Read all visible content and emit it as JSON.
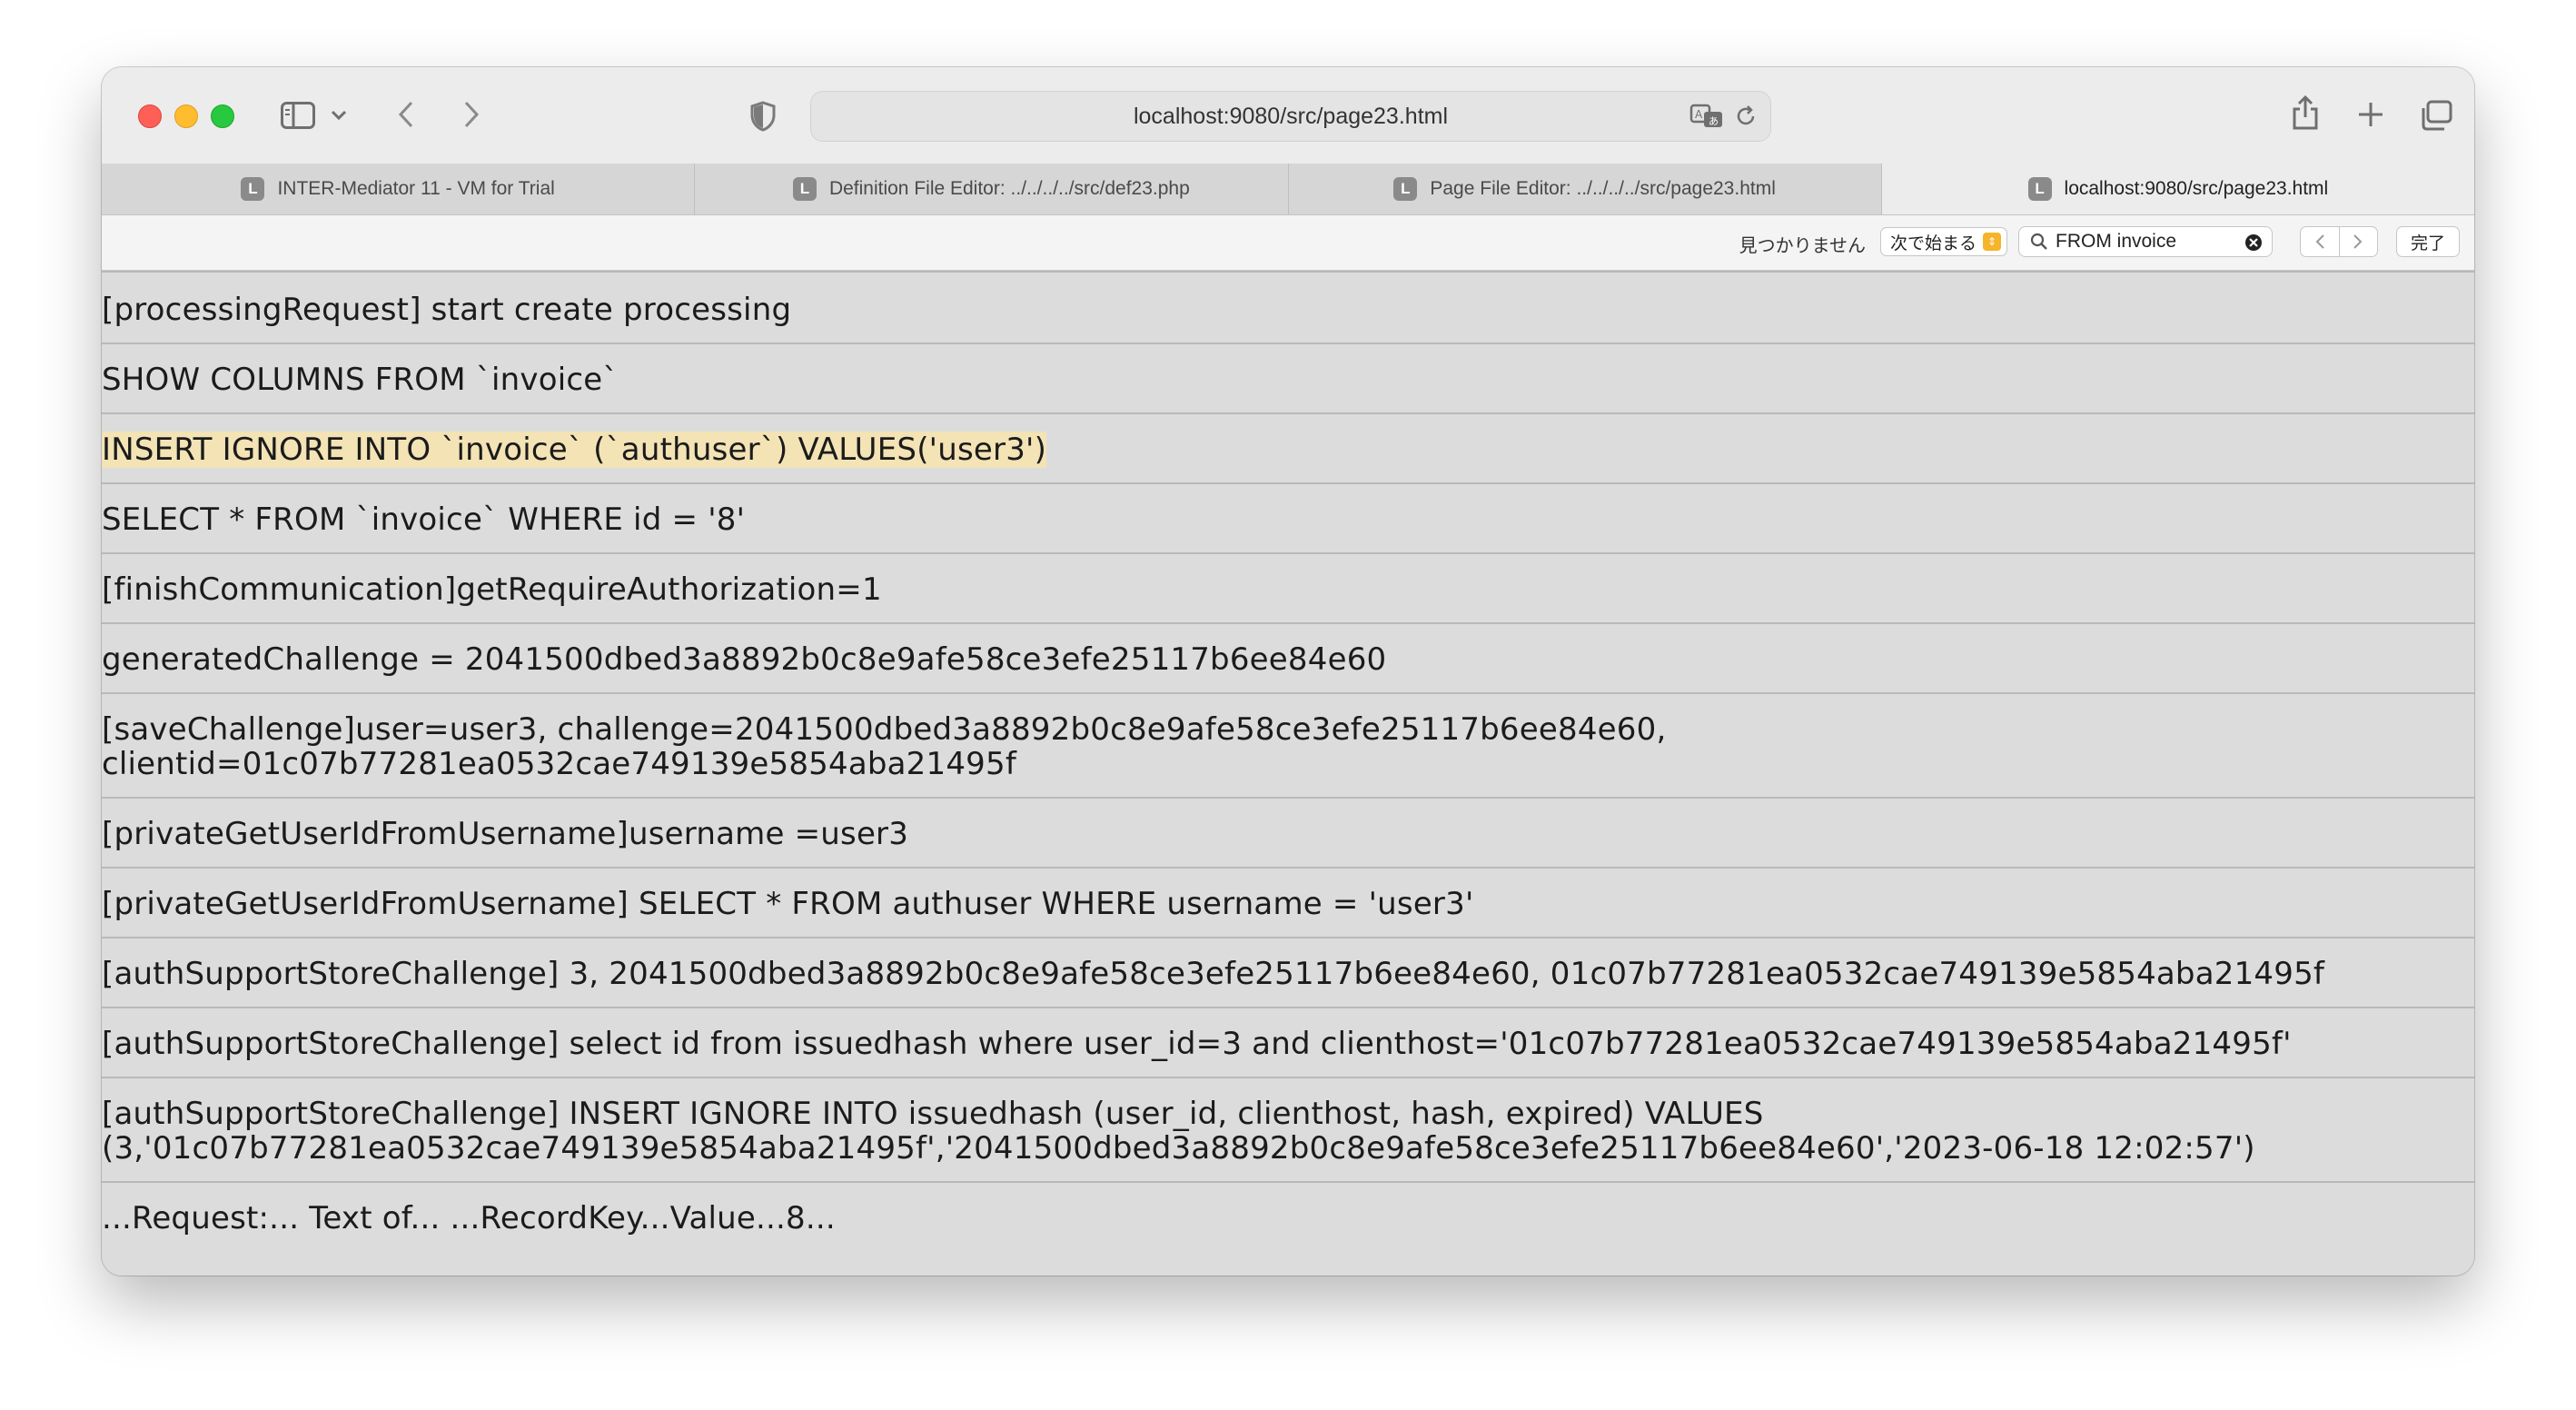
{
  "address_bar": {
    "url": "localhost:9080/src/page23.html"
  },
  "tabs": [
    {
      "label": "INTER-Mediator 11 - VM for Trial",
      "favicon": "L"
    },
    {
      "label": "Definition File Editor: ../../../../src/def23.php",
      "favicon": "L"
    },
    {
      "label": "Page File Editor: ../../../../src/page23.html",
      "favicon": "L"
    },
    {
      "label": "localhost:9080/src/page23.html",
      "favicon": "L"
    }
  ],
  "find_bar": {
    "status": "見つかりません",
    "mode": "次で始まる",
    "query": "FROM invoice",
    "done_label": "完了"
  },
  "log": {
    "rows": [
      "[processingRequest] start create processing",
      "SHOW COLUMNS FROM `invoice`",
      "INSERT IGNORE INTO `invoice` (`authuser`) VALUES('user3')",
      "SELECT * FROM `invoice` WHERE id = '8'",
      "[finishCommunication]getRequireAuthorization=1",
      "generatedChallenge = 2041500dbed3a8892b0c8e9afe58ce3efe25117b6ee84e60",
      "[saveChallenge]user=user3, challenge=2041500dbed3a8892b0c8e9afe58ce3efe25117b6ee84e60,\nclientid=01c07b77281ea0532cae749139e5854aba21495f",
      "[privateGetUserIdFromUsername]username =user3",
      "[privateGetUserIdFromUsername] SELECT * FROM authuser WHERE username = 'user3'",
      "[authSupportStoreChallenge] 3, 2041500dbed3a8892b0c8e9afe58ce3efe25117b6ee84e60, 01c07b77281ea0532cae749139e5854aba21495f",
      "[authSupportStoreChallenge] select id from issuedhash where user_id=3 and clienthost='01c07b77281ea0532cae749139e5854aba21495f'",
      "[authSupportStoreChallenge] INSERT IGNORE INTO issuedhash (user_id, clienthost, hash, expired) VALUES\n(3,'01c07b77281ea0532cae749139e5854aba21495f','2041500dbed3a8892b0c8e9afe58ce3efe25117b6ee84e60','2023-06-18 12:02:57')",
      "...Request:... Text of... ...RecordKey...Value...8..."
    ]
  }
}
